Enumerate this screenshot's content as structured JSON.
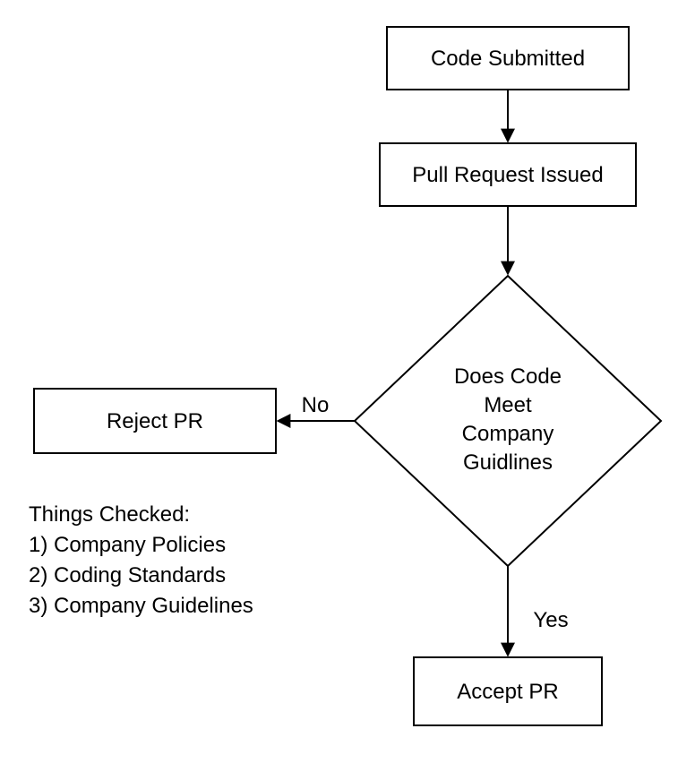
{
  "nodes": {
    "submitted": "Code Submitted",
    "pr_issued": "Pull Request Issued",
    "decision_l1": "Does Code",
    "decision_l2": "Meet",
    "decision_l3": "Company",
    "decision_l4": "Guidlines",
    "reject": "Reject PR",
    "accept": "Accept PR"
  },
  "edges": {
    "no": "No",
    "yes": "Yes"
  },
  "notes": {
    "title": "Things Checked:",
    "i1": "1) Company Policies",
    "i2": "2) Coding Standards",
    "i3": "3) Company Guidelines"
  }
}
